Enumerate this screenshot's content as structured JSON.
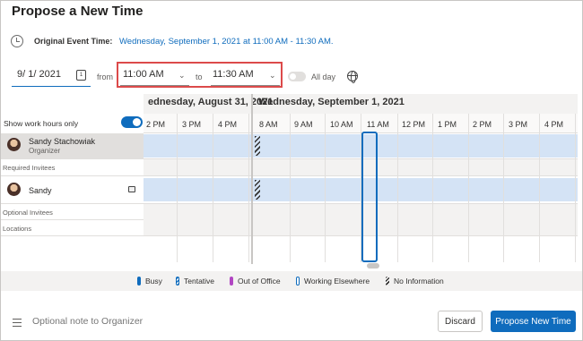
{
  "dialog": {
    "title": "Propose a New Time"
  },
  "original_event": {
    "label": "Original Event Time:",
    "value": "Wednesday, September 1, 2021 at 11:00 AM - 11:30 AM."
  },
  "time_row": {
    "date_value": "9/  1/ 2021",
    "calendar_icon": "calendar-icon",
    "from_label": "from",
    "start_time": "11:00 AM",
    "to_label": "to",
    "end_time": "11:30 AM",
    "all_day_label": "All day",
    "all_day_on": false
  },
  "scheduler": {
    "day_prev": "ednesday, August 31, 2021",
    "day_current": "Wednesday, September 1, 2021",
    "work_hours_label": "Show work hours only",
    "work_hours_on": true,
    "hours_prev": [
      "2 PM",
      "3 PM",
      "4 PM"
    ],
    "hours_current": [
      "8 AM",
      "9 AM",
      "10 AM",
      "11 AM",
      "12 PM",
      "1 PM",
      "2 PM",
      "3 PM",
      "4 PM"
    ],
    "attendees": [
      {
        "name": "Sandy Stachowiak",
        "role": "Organizer"
      },
      {
        "name": "Sandy",
        "role": ""
      }
    ],
    "section_required": "Required Invitees",
    "section_optional": "Optional Invitees",
    "section_locations": "Locations"
  },
  "legend": {
    "busy": "Busy",
    "tentative": "Tentative",
    "out_of_office": "Out of Office",
    "working_elsewhere": "Working Elsewhere",
    "no_information": "No Information"
  },
  "footer": {
    "note_placeholder": "Optional note to Organizer",
    "discard_label": "Discard",
    "propose_label": "Propose New Time"
  },
  "colors": {
    "accent": "#0f6cbd",
    "highlight_box": "#dc4a4a",
    "busy_fill": "#d4e3f5"
  }
}
